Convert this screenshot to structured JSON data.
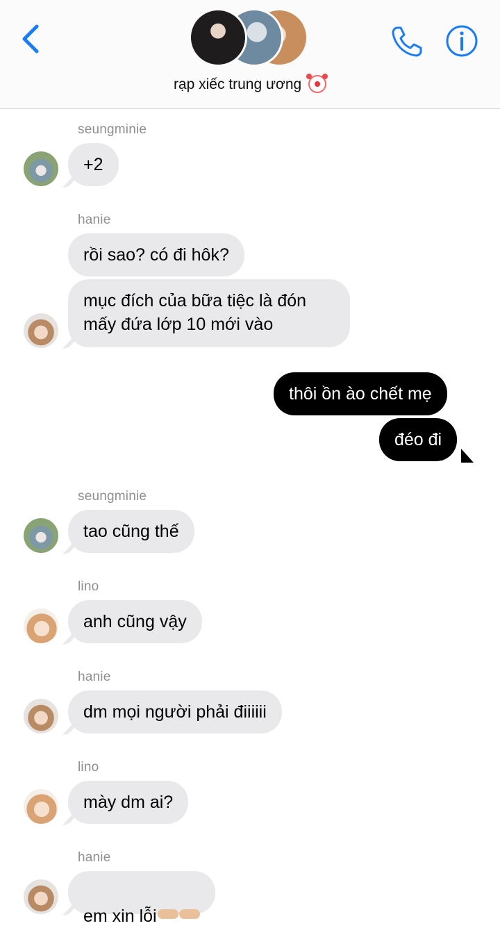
{
  "header": {
    "group_name": "rạp xiếc trung ương",
    "back_icon": "chevron-left-icon",
    "call_icon": "phone-icon",
    "info_icon": "info-icon",
    "accent_color": "#1a7cf5"
  },
  "messages": [
    {
      "sender": "seungminie",
      "text": "+2"
    },
    {
      "sender": "hanie",
      "text": "rồi sao? có đi hôk?"
    },
    {
      "sender": "hanie",
      "text": "mục đích của bữa tiệc là đón\nmấy đứa lớp 10 mới vào"
    },
    {
      "sender": "me",
      "text": "thôi ồn ào chết mẹ"
    },
    {
      "sender": "me",
      "text": "đéo đi"
    },
    {
      "sender": "seungminie",
      "text": "tao cũng thế"
    },
    {
      "sender": "lino",
      "text": "anh cũng vậy"
    },
    {
      "sender": "hanie",
      "text": "dm mọi người phải điiiiii"
    },
    {
      "sender": "lino",
      "text": "mày dm ai?"
    },
    {
      "sender": "hanie",
      "text": "em xin lỗi"
    }
  ],
  "colors": {
    "incoming_bubble": "#e9e9eb",
    "outgoing_bubble": "#000000",
    "sender_label": "#8e8e93"
  }
}
